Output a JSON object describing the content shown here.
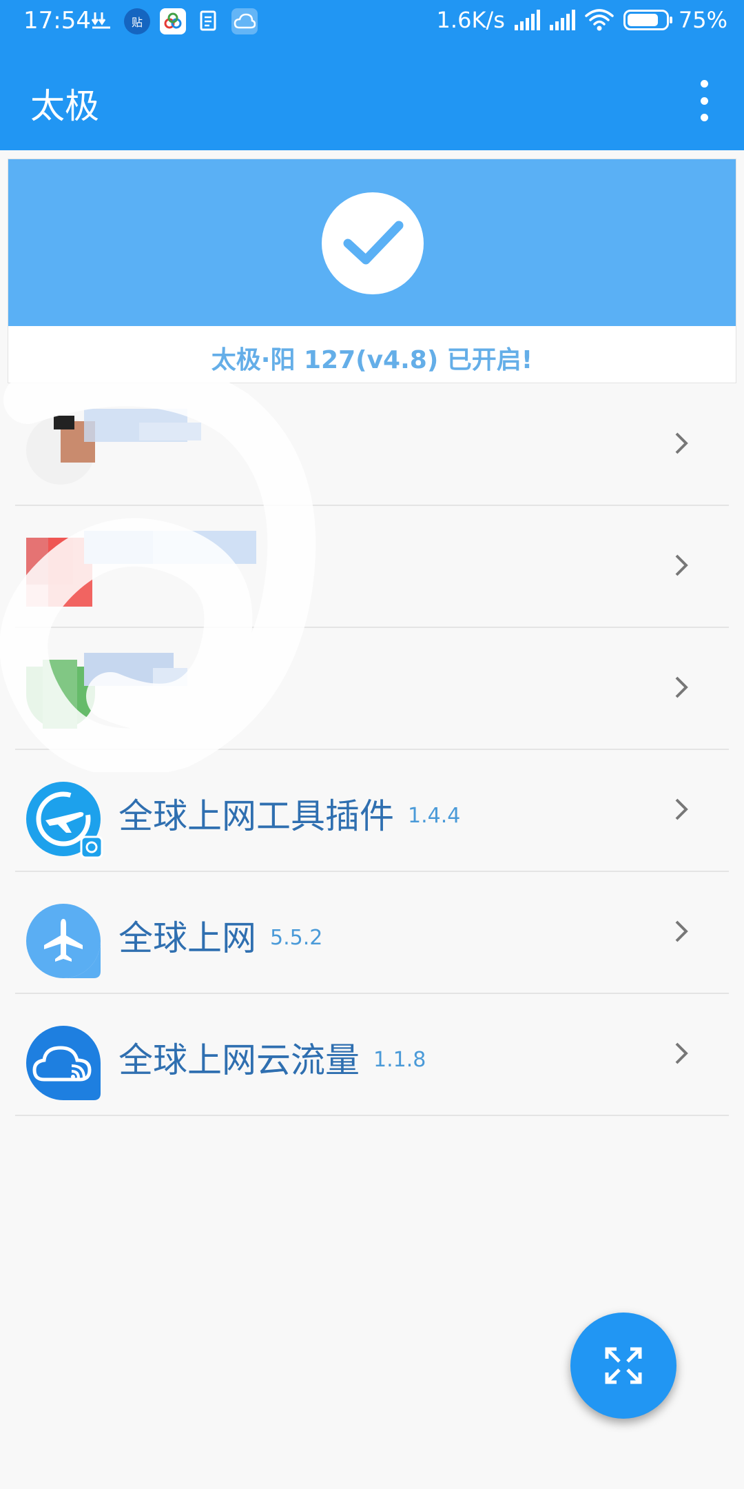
{
  "status_bar": {
    "time": "17:54",
    "net_speed": "1.6K/s",
    "battery": "75%",
    "notification_icons": [
      "download-icon",
      "tieba-icon",
      "baidu-netdisk-icon",
      "document-icon",
      "cloud-icon"
    ]
  },
  "app_bar": {
    "title": "太极",
    "menu_icon": "more-vert-icon"
  },
  "status_card": {
    "message": "太极·阳 127(v4.8) 已开启!",
    "icon": "check-icon"
  },
  "modules": [
    {
      "name": "",
      "version": "",
      "icon": "app-icon",
      "obscured": true
    },
    {
      "name": "",
      "version": "",
      "icon": "app-icon",
      "obscured": true
    },
    {
      "name": "",
      "version": "",
      "icon": "app-icon",
      "obscured": true
    },
    {
      "name": "全球上网工具插件",
      "version": "1.4.4",
      "icon": "plane-gear-icon"
    },
    {
      "name": "全球上网",
      "version": "5.5.2",
      "icon": "plane-icon"
    },
    {
      "name": "全球上网云流量",
      "version": "1.1.8",
      "icon": "cloud-wifi-icon"
    }
  ],
  "fab": {
    "icon": "expand-arrows-icon"
  },
  "colors": {
    "primary": "#2196f3",
    "card_header": "#5ab0f5",
    "title_text": "#2f6fb0"
  }
}
